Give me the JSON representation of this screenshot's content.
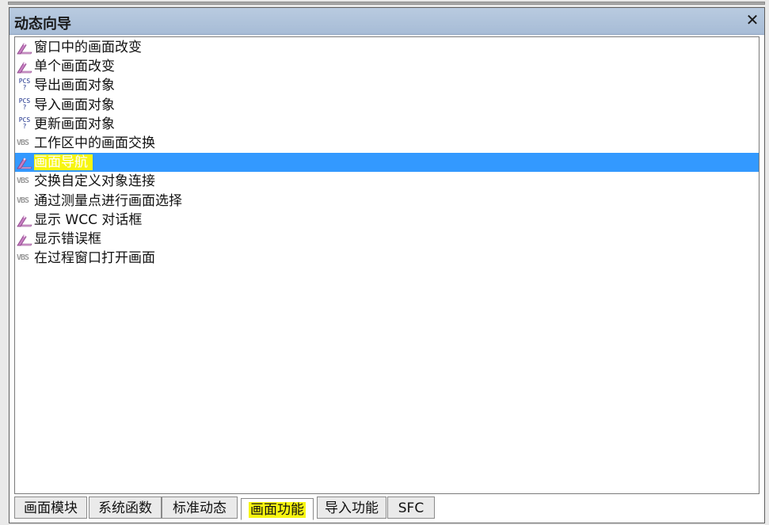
{
  "window": {
    "title": "动态向导",
    "close_symbol": "✕"
  },
  "list": {
    "items": [
      {
        "label": "窗口中的画面改变",
        "icon": "wizard-wand-icon",
        "selected": false
      },
      {
        "label": "单个画面改变",
        "icon": "wizard-wand-icon",
        "selected": false
      },
      {
        "label": "导出画面对象",
        "icon": "pcs-script-icon",
        "selected": false
      },
      {
        "label": "导入画面对象",
        "icon": "pcs-script-icon",
        "selected": false
      },
      {
        "label": "更新画面对象",
        "icon": "pcs-script-icon",
        "selected": false
      },
      {
        "label": "工作区中的画面交换",
        "icon": "vbs-script-icon",
        "selected": false
      },
      {
        "label": "画面导航",
        "icon": "wizard-wand-icon",
        "selected": true
      },
      {
        "label": "交换自定义对象连接",
        "icon": "vbs-script-icon",
        "selected": false
      },
      {
        "label": "通过测量点进行画面选择",
        "icon": "vbs-script-icon",
        "selected": false
      },
      {
        "label": "显示 WCC 对话框",
        "icon": "wizard-wand-icon",
        "selected": false
      },
      {
        "label": "显示错误框",
        "icon": "wizard-wand-icon",
        "selected": false
      },
      {
        "label": "在过程窗口打开画面",
        "icon": "vbs-script-icon",
        "selected": false
      }
    ]
  },
  "tabs": [
    {
      "label": "画面模块",
      "active": false
    },
    {
      "label": "系统函数",
      "active": false
    },
    {
      "label": "标准动态",
      "active": false
    },
    {
      "label": "画面功能",
      "active": true
    },
    {
      "label": "导入功能",
      "active": false
    },
    {
      "label": "SFC",
      "active": false
    }
  ],
  "colors": {
    "selection": "#3399ff",
    "highlight": "#f7f511",
    "titlebar": "#a7bcd6"
  },
  "icon_text": {
    "pcs": "PCS\n?",
    "vbs": "VBS"
  }
}
